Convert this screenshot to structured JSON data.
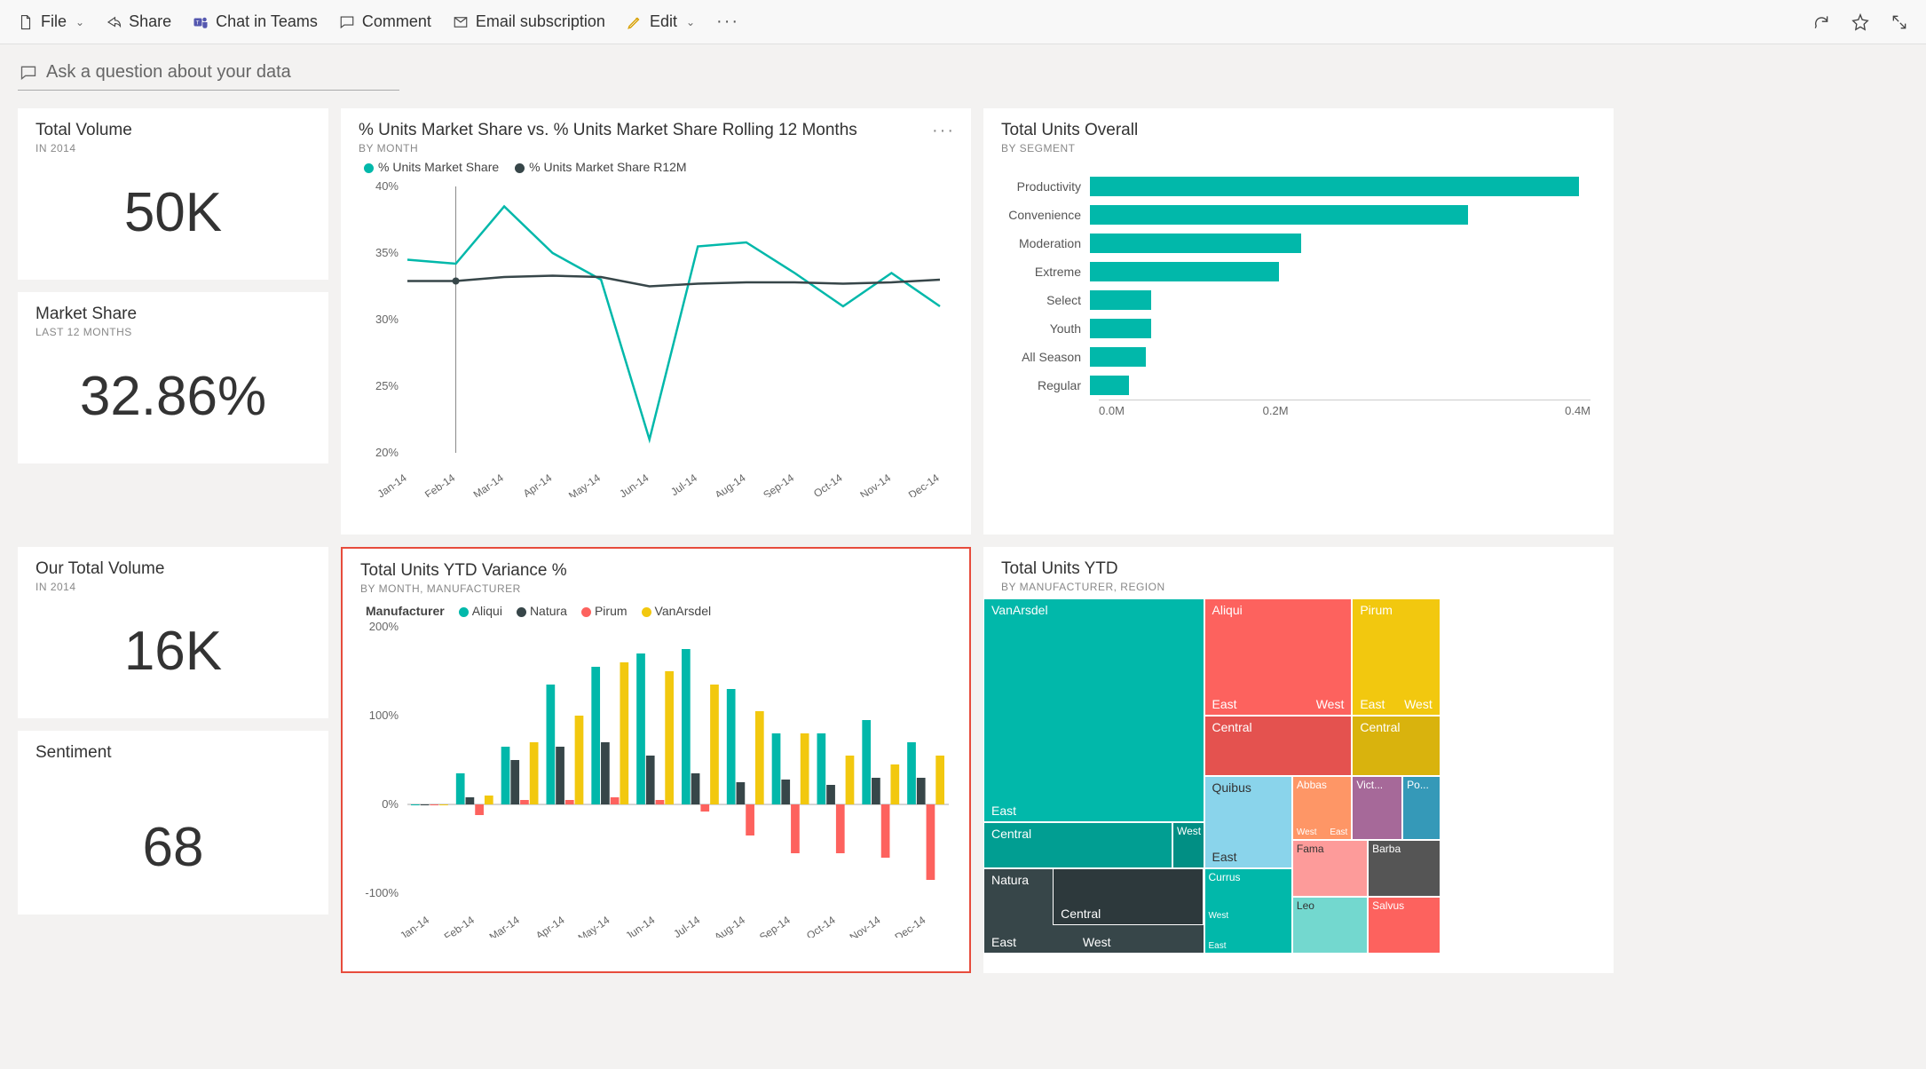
{
  "toolbar": {
    "file": "File",
    "share": "Share",
    "chat": "Chat in Teams",
    "comment": "Comment",
    "email": "Email subscription",
    "edit": "Edit"
  },
  "qa_placeholder": "Ask a question about your data",
  "kpi": {
    "total_volume": {
      "title": "Total Volume",
      "sub": "IN 2014",
      "value": "50K"
    },
    "market_share": {
      "title": "Market Share",
      "sub": "LAST 12 MONTHS",
      "value": "32.86%"
    },
    "our_total_volume": {
      "title": "Our Total Volume",
      "sub": "IN 2014",
      "value": "16K"
    },
    "sentiment": {
      "title": "Sentiment",
      "sub": "",
      "value": "68"
    }
  },
  "line_chart": {
    "title": "% Units Market Share vs. % Units Market Share Rolling 12 Months",
    "sub": "BY MONTH",
    "legend1": "% Units Market Share",
    "legend2": "% Units Market Share R12M"
  },
  "hbar_chart": {
    "title": "Total Units Overall",
    "sub": "BY SEGMENT",
    "axis0": "0.0M",
    "axis1": "0.2M",
    "axis2": "0.4M"
  },
  "ytdvar": {
    "title": "Total Units YTD Variance %",
    "sub": "BY MONTH, MANUFACTURER",
    "legend_title": "Manufacturer",
    "m1": "Aliqui",
    "m2": "Natura",
    "m3": "Pirum",
    "m4": "VanArsdel"
  },
  "treemap": {
    "title": "Total Units YTD",
    "sub": "BY MANUFACTURER, REGION"
  },
  "chart_data": [
    {
      "name": "line_market_share",
      "type": "line",
      "title": "% Units Market Share vs. % Units Market Share Rolling 12 Months",
      "xlabel": "",
      "ylabel": "",
      "ylim": [
        20,
        40
      ],
      "categories": [
        "Jan-14",
        "Feb-14",
        "Mar-14",
        "Apr-14",
        "May-14",
        "Jun-14",
        "Jul-14",
        "Aug-14",
        "Sep-14",
        "Oct-14",
        "Nov-14",
        "Dec-14"
      ],
      "series": [
        {
          "name": "% Units Market Share",
          "color": "#01b8aa",
          "values": [
            34.5,
            34.2,
            38.5,
            35.0,
            33.0,
            21.0,
            35.5,
            35.8,
            33.5,
            31.0,
            33.5,
            31.0
          ]
        },
        {
          "name": "% Units Market Share R12M",
          "color": "#374649",
          "values": [
            32.9,
            32.9,
            33.2,
            33.3,
            33.2,
            32.5,
            32.7,
            32.8,
            32.8,
            32.7,
            32.8,
            33.0
          ]
        }
      ]
    },
    {
      "name": "bar_total_units_segment",
      "type": "bar",
      "orientation": "horizontal",
      "title": "Total Units Overall",
      "xlabel": "",
      "ylabel": "",
      "xlim": [
        0,
        0.45
      ],
      "unit": "M",
      "categories": [
        "Productivity",
        "Convenience",
        "Moderation",
        "Extreme",
        "Select",
        "Youth",
        "All Season",
        "Regular"
      ],
      "values": [
        0.44,
        0.34,
        0.19,
        0.17,
        0.055,
        0.055,
        0.05,
        0.035
      ]
    },
    {
      "name": "grouped_ytd_variance",
      "type": "bar",
      "grouped": true,
      "title": "Total Units YTD Variance %",
      "ylabel": "",
      "xlabel": "",
      "ylim": [
        -100,
        200
      ],
      "categories": [
        "Jan-14",
        "Feb-14",
        "Mar-14",
        "Apr-14",
        "May-14",
        "Jun-14",
        "Jul-14",
        "Aug-14",
        "Sep-14",
        "Oct-14",
        "Nov-14",
        "Dec-14"
      ],
      "series": [
        {
          "name": "Aliqui",
          "color": "#01b8aa",
          "values": [
            0,
            35,
            65,
            135,
            155,
            170,
            175,
            130,
            80,
            80,
            95,
            70
          ]
        },
        {
          "name": "Natura",
          "color": "#374649",
          "values": [
            0,
            8,
            50,
            65,
            70,
            55,
            35,
            25,
            28,
            22,
            30,
            30
          ]
        },
        {
          "name": "Pirum",
          "color": "#fd625e",
          "values": [
            0,
            -12,
            5,
            5,
            8,
            5,
            -8,
            -35,
            -55,
            -55,
            -60,
            -85
          ]
        },
        {
          "name": "VanArsdel",
          "color": "#f2c80f",
          "values": [
            0,
            10,
            70,
            100,
            160,
            150,
            135,
            105,
            80,
            55,
            45,
            55
          ]
        }
      ]
    },
    {
      "name": "treemap_units_ytd",
      "type": "treemap",
      "title": "Total Units YTD",
      "groups": [
        {
          "name": "VanArsdel",
          "color": "#01b8aa",
          "children": [
            {
              "name": "East",
              "value": 95
            },
            {
              "name": "Central",
              "value": 70
            },
            {
              "name": "West",
              "value": 15
            }
          ]
        },
        {
          "name": "Aliqui",
          "color": "#fd625e",
          "children": [
            {
              "name": "East",
              "value": 30
            },
            {
              "name": "West",
              "value": 20
            },
            {
              "name": "Central",
              "value": 45
            }
          ]
        },
        {
          "name": "Pirum",
          "color": "#f2c80f",
          "children": [
            {
              "name": "East",
              "value": 25
            },
            {
              "name": "West",
              "value": 15
            },
            {
              "name": "Central",
              "value": 30
            }
          ]
        },
        {
          "name": "Natura",
          "color": "#374649",
          "children": [
            {
              "name": "East",
              "value": 30
            },
            {
              "name": "Central",
              "value": 35
            },
            {
              "name": "West",
              "value": 30
            }
          ]
        },
        {
          "name": "Quibus",
          "color": "#8ad4eb",
          "children": [
            {
              "name": "East",
              "value": 20
            }
          ]
        },
        {
          "name": "Abbas",
          "color": "#fe9666",
          "children": [
            {
              "name": "West",
              "value": 8
            },
            {
              "name": "East",
              "value": 6
            }
          ]
        },
        {
          "name": "Vict...",
          "color": "#a66999",
          "children": [
            {
              "name": "",
              "value": 10
            }
          ]
        },
        {
          "name": "Po...",
          "color": "#3599b8",
          "children": [
            {
              "name": "",
              "value": 8
            }
          ]
        },
        {
          "name": "Currus",
          "color": "#01b8aa",
          "children": [
            {
              "name": "East",
              "value": 8
            },
            {
              "name": "West",
              "value": 6
            }
          ]
        },
        {
          "name": "Fama",
          "color": "#fd9b9a",
          "children": [
            {
              "name": "",
              "value": 10
            }
          ]
        },
        {
          "name": "Barba",
          "color": "#555555",
          "children": [
            {
              "name": "",
              "value": 10
            }
          ]
        },
        {
          "name": "Leo",
          "color": "#73d8cf",
          "children": [
            {
              "name": "",
              "value": 8
            }
          ]
        },
        {
          "name": "Salvus",
          "color": "#fd625e",
          "children": [
            {
              "name": "",
              "value": 8
            }
          ]
        }
      ]
    }
  ]
}
